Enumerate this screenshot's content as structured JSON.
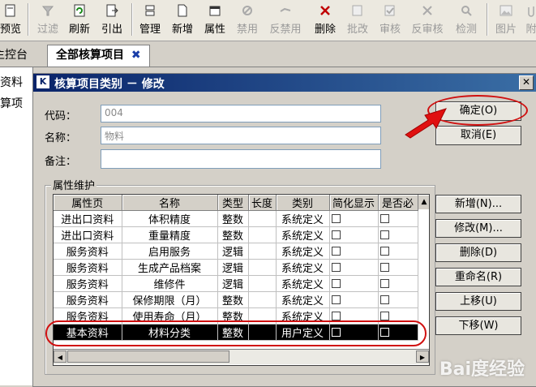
{
  "toolbar": {
    "buttons": [
      {
        "label": "预览",
        "icon": "preview-icon",
        "disabled": false
      },
      {
        "label": "过滤",
        "icon": "filter-icon",
        "disabled": true
      },
      {
        "label": "刷新",
        "icon": "refresh-icon",
        "disabled": false
      },
      {
        "label": "引出",
        "icon": "export-icon",
        "disabled": false
      },
      {
        "label": "管理",
        "icon": "manage-icon",
        "disabled": false
      },
      {
        "label": "新增",
        "icon": "new-icon",
        "disabled": false
      },
      {
        "label": "属性",
        "icon": "properties-icon",
        "disabled": false
      },
      {
        "label": "禁用",
        "icon": "disable-icon",
        "disabled": true
      },
      {
        "label": "反禁用",
        "icon": "enable-icon",
        "disabled": true
      },
      {
        "label": "删除",
        "icon": "delete-icon",
        "disabled": false
      },
      {
        "label": "批改",
        "icon": "batch-edit-icon",
        "disabled": true
      },
      {
        "label": "审核",
        "icon": "approve-icon",
        "disabled": true
      },
      {
        "label": "反审核",
        "icon": "unapprove-icon",
        "disabled": true
      },
      {
        "label": "检测",
        "icon": "check-icon",
        "disabled": true
      },
      {
        "label": "图片",
        "icon": "image-icon",
        "disabled": true
      },
      {
        "label": "附",
        "icon": "attachment-icon",
        "disabled": true
      }
    ]
  },
  "tabs": {
    "inactive_label": "主控台",
    "active_label": "全部核算项目",
    "close_symbol": "✖"
  },
  "left_panel": {
    "items": [
      "目资料",
      "核算项"
    ]
  },
  "dialog": {
    "logo": "K",
    "title": "核算项目类别 － 修改",
    "close_symbol": "✕",
    "code_label": "代码：",
    "code_value": "004",
    "name_label": "名称：",
    "name_value": "物料",
    "note_label": "备注：",
    "note_value": "",
    "ok_button": "确定(O)",
    "cancel_button": "取消(E)",
    "group_title": "属性维护",
    "side_buttons": [
      "新增(N)...",
      "修改(M)...",
      "删除(D)",
      "重命名(R)",
      "上移(U)",
      "下移(W)"
    ]
  },
  "grid": {
    "columns": [
      "属性页",
      "名称",
      "类型",
      "长度",
      "类别",
      "简化显示",
      "是否必"
    ],
    "rows": [
      {
        "page": "进出口资料",
        "name": "体积精度",
        "type": "整数",
        "length": "",
        "category": "系统定义",
        "selected": false
      },
      {
        "page": "进出口资料",
        "name": "重量精度",
        "type": "整数",
        "length": "",
        "category": "系统定义",
        "selected": false
      },
      {
        "page": "服务资料",
        "name": "启用服务",
        "type": "逻辑",
        "length": "",
        "category": "系统定义",
        "selected": false
      },
      {
        "page": "服务资料",
        "name": "生成产品档案",
        "type": "逻辑",
        "length": "",
        "category": "系统定义",
        "selected": false
      },
      {
        "page": "服务资料",
        "name": "维修件",
        "type": "逻辑",
        "length": "",
        "category": "系统定义",
        "selected": false
      },
      {
        "page": "服务资料",
        "name": "保修期限（月）",
        "type": "整数",
        "length": "",
        "category": "系统定义",
        "selected": false
      },
      {
        "page": "服务资料",
        "name": "使用寿命（月）",
        "type": "整数",
        "length": "",
        "category": "系统定义",
        "selected": false
      },
      {
        "page": "基本资料",
        "name": "材料分类",
        "type": "整数",
        "length": "",
        "category": "用户定义",
        "selected": true
      }
    ]
  },
  "watermark": "Bai度经验"
}
